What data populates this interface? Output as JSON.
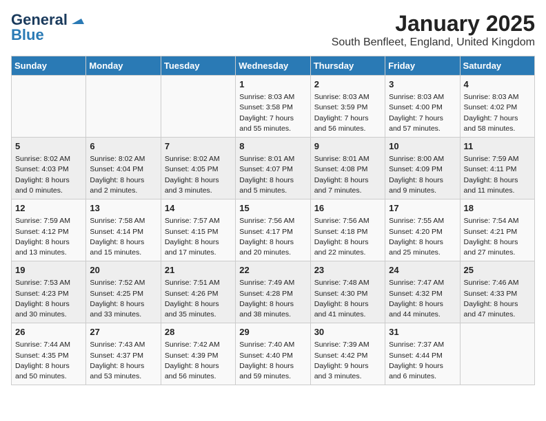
{
  "logo": {
    "line1": "General",
    "line2": "Blue"
  },
  "header": {
    "month": "January 2025",
    "location": "South Benfleet, England, United Kingdom"
  },
  "weekdays": [
    "Sunday",
    "Monday",
    "Tuesday",
    "Wednesday",
    "Thursday",
    "Friday",
    "Saturday"
  ],
  "weeks": [
    [
      {
        "day": "",
        "detail": ""
      },
      {
        "day": "",
        "detail": ""
      },
      {
        "day": "",
        "detail": ""
      },
      {
        "day": "1",
        "detail": "Sunrise: 8:03 AM\nSunset: 3:58 PM\nDaylight: 7 hours\nand 55 minutes."
      },
      {
        "day": "2",
        "detail": "Sunrise: 8:03 AM\nSunset: 3:59 PM\nDaylight: 7 hours\nand 56 minutes."
      },
      {
        "day": "3",
        "detail": "Sunrise: 8:03 AM\nSunset: 4:00 PM\nDaylight: 7 hours\nand 57 minutes."
      },
      {
        "day": "4",
        "detail": "Sunrise: 8:03 AM\nSunset: 4:02 PM\nDaylight: 7 hours\nand 58 minutes."
      }
    ],
    [
      {
        "day": "5",
        "detail": "Sunrise: 8:02 AM\nSunset: 4:03 PM\nDaylight: 8 hours\nand 0 minutes."
      },
      {
        "day": "6",
        "detail": "Sunrise: 8:02 AM\nSunset: 4:04 PM\nDaylight: 8 hours\nand 2 minutes."
      },
      {
        "day": "7",
        "detail": "Sunrise: 8:02 AM\nSunset: 4:05 PM\nDaylight: 8 hours\nand 3 minutes."
      },
      {
        "day": "8",
        "detail": "Sunrise: 8:01 AM\nSunset: 4:07 PM\nDaylight: 8 hours\nand 5 minutes."
      },
      {
        "day": "9",
        "detail": "Sunrise: 8:01 AM\nSunset: 4:08 PM\nDaylight: 8 hours\nand 7 minutes."
      },
      {
        "day": "10",
        "detail": "Sunrise: 8:00 AM\nSunset: 4:09 PM\nDaylight: 8 hours\nand 9 minutes."
      },
      {
        "day": "11",
        "detail": "Sunrise: 7:59 AM\nSunset: 4:11 PM\nDaylight: 8 hours\nand 11 minutes."
      }
    ],
    [
      {
        "day": "12",
        "detail": "Sunrise: 7:59 AM\nSunset: 4:12 PM\nDaylight: 8 hours\nand 13 minutes."
      },
      {
        "day": "13",
        "detail": "Sunrise: 7:58 AM\nSunset: 4:14 PM\nDaylight: 8 hours\nand 15 minutes."
      },
      {
        "day": "14",
        "detail": "Sunrise: 7:57 AM\nSunset: 4:15 PM\nDaylight: 8 hours\nand 17 minutes."
      },
      {
        "day": "15",
        "detail": "Sunrise: 7:56 AM\nSunset: 4:17 PM\nDaylight: 8 hours\nand 20 minutes."
      },
      {
        "day": "16",
        "detail": "Sunrise: 7:56 AM\nSunset: 4:18 PM\nDaylight: 8 hours\nand 22 minutes."
      },
      {
        "day": "17",
        "detail": "Sunrise: 7:55 AM\nSunset: 4:20 PM\nDaylight: 8 hours\nand 25 minutes."
      },
      {
        "day": "18",
        "detail": "Sunrise: 7:54 AM\nSunset: 4:21 PM\nDaylight: 8 hours\nand 27 minutes."
      }
    ],
    [
      {
        "day": "19",
        "detail": "Sunrise: 7:53 AM\nSunset: 4:23 PM\nDaylight: 8 hours\nand 30 minutes."
      },
      {
        "day": "20",
        "detail": "Sunrise: 7:52 AM\nSunset: 4:25 PM\nDaylight: 8 hours\nand 33 minutes."
      },
      {
        "day": "21",
        "detail": "Sunrise: 7:51 AM\nSunset: 4:26 PM\nDaylight: 8 hours\nand 35 minutes."
      },
      {
        "day": "22",
        "detail": "Sunrise: 7:49 AM\nSunset: 4:28 PM\nDaylight: 8 hours\nand 38 minutes."
      },
      {
        "day": "23",
        "detail": "Sunrise: 7:48 AM\nSunset: 4:30 PM\nDaylight: 8 hours\nand 41 minutes."
      },
      {
        "day": "24",
        "detail": "Sunrise: 7:47 AM\nSunset: 4:32 PM\nDaylight: 8 hours\nand 44 minutes."
      },
      {
        "day": "25",
        "detail": "Sunrise: 7:46 AM\nSunset: 4:33 PM\nDaylight: 8 hours\nand 47 minutes."
      }
    ],
    [
      {
        "day": "26",
        "detail": "Sunrise: 7:44 AM\nSunset: 4:35 PM\nDaylight: 8 hours\nand 50 minutes."
      },
      {
        "day": "27",
        "detail": "Sunrise: 7:43 AM\nSunset: 4:37 PM\nDaylight: 8 hours\nand 53 minutes."
      },
      {
        "day": "28",
        "detail": "Sunrise: 7:42 AM\nSunset: 4:39 PM\nDaylight: 8 hours\nand 56 minutes."
      },
      {
        "day": "29",
        "detail": "Sunrise: 7:40 AM\nSunset: 4:40 PM\nDaylight: 8 hours\nand 59 minutes."
      },
      {
        "day": "30",
        "detail": "Sunrise: 7:39 AM\nSunset: 4:42 PM\nDaylight: 9 hours\nand 3 minutes."
      },
      {
        "day": "31",
        "detail": "Sunrise: 7:37 AM\nSunset: 4:44 PM\nDaylight: 9 hours\nand 6 minutes."
      },
      {
        "day": "",
        "detail": ""
      }
    ]
  ]
}
